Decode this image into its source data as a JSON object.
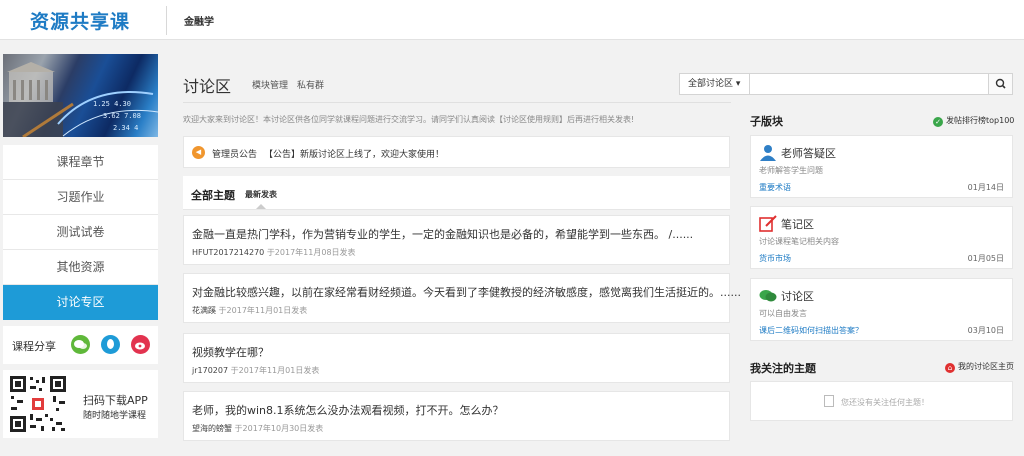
{
  "header": {
    "logo": "资源共享课",
    "course": "金融学"
  },
  "sidebar": {
    "items": [
      {
        "label": "课程章节"
      },
      {
        "label": "习题作业"
      },
      {
        "label": "测试试卷"
      },
      {
        "label": "其他资源"
      },
      {
        "label": "讨论专区"
      }
    ],
    "share_label": "课程分享",
    "share_icons": [
      "wechat-icon",
      "qq-icon",
      "weibo-icon"
    ],
    "qr_title": "扫码下载APP",
    "qr_sub": "随时随地学课程"
  },
  "main": {
    "title": "讨论区",
    "links": {
      "manage": "模块管理",
      "private": "私有群"
    },
    "search": {
      "select": "全部讨论区 ▾",
      "placeholder": ""
    },
    "welcome": "欢迎大家来到讨论区！本讨论区供各位同学就课程问题进行交流学习。请同学们认真阅读【讨论区使用规则】后再进行相关发表!",
    "notice": {
      "tag": "管理员公告",
      "text": "【公告】新版讨论区上线了，欢迎大家使用！"
    },
    "tabs": {
      "all": "全部主题",
      "latest": "最新发表"
    },
    "topics": [
      {
        "title": "金融一直是热门学科，作为营销专业的学生，一定的金融知识也是必备的，希望能学到一些东西。 /......",
        "author": "HFUT2017214270",
        "time": "于2017年11月08日发表"
      },
      {
        "title": "对金融比较感兴趣，以前在家经常看财经频道。今天看到了李健教授的经济敏感度，感觉离我们生活挺近的。......",
        "author": "花满蹊",
        "time": "于2017年11月01日发表"
      },
      {
        "title": "视频教学在哪？",
        "author": "jr170207",
        "time": "于2017年11月01日发表"
      },
      {
        "title": "老师，我的win8.1系统怎么没办法观看视频，打不开。怎么办？",
        "author": "望海的螃蟹",
        "time": "于2017年10月30日发表"
      }
    ]
  },
  "right": {
    "sub_heading": "子版块",
    "top_link": "发帖排行榜top100",
    "boards": [
      {
        "name": "老师答疑区",
        "desc": "老师解答学生问题",
        "latest": "重要术语",
        "date": "01月14日",
        "icon": "teacher-icon"
      },
      {
        "name": "笔记区",
        "desc": "讨论课程笔记相关内容",
        "latest": "货币市场",
        "date": "01月05日",
        "icon": "note-icon"
      },
      {
        "name": "讨论区",
        "desc": "可以自由发言",
        "latest": "课后二维码如何扫描出答案？",
        "date": "03月10日",
        "icon": "chat-icon"
      }
    ],
    "follow_heading": "我关注的主题",
    "my_link": "我的讨论区主页",
    "follow_empty": "您还没有关注任何主题！"
  },
  "colors": {
    "accent": "#1e9bd7",
    "logo": "#1e7bc4",
    "notice": "#f0962e"
  }
}
